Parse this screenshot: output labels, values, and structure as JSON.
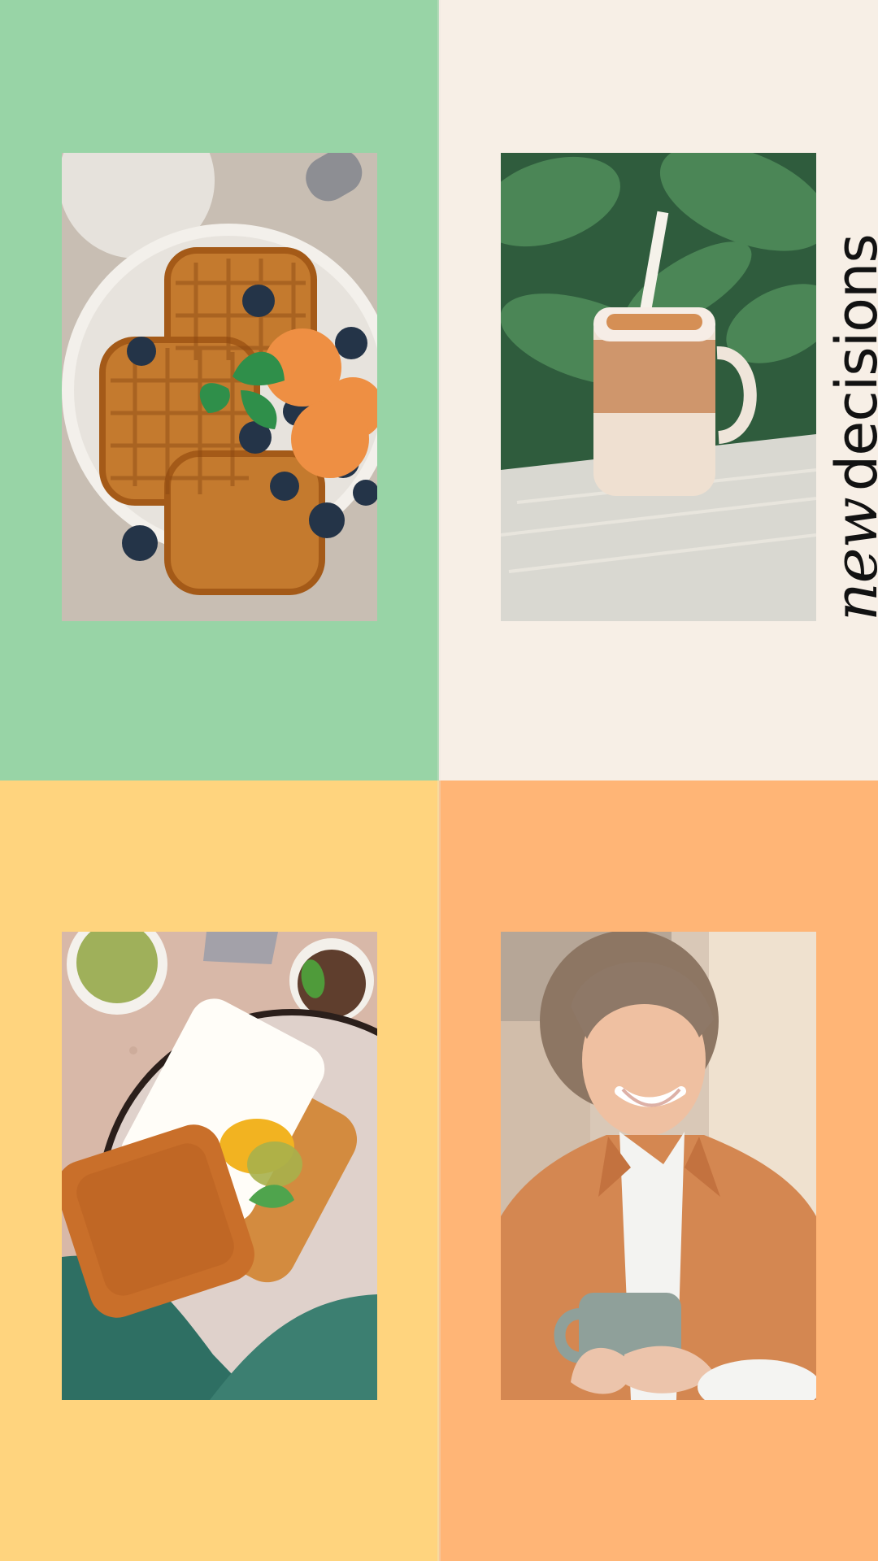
{
  "headline": {
    "script_word": "new",
    "main_word": "decisions"
  },
  "panels": [
    {
      "name": "waffles-panel",
      "background": "#98d4a6"
    },
    {
      "name": "iced-coffee-panel",
      "background": "#f7efe6"
    },
    {
      "name": "toast-panel",
      "background": "#ffd47e"
    },
    {
      "name": "woman-panel",
      "background": "#ffb576"
    }
  ]
}
